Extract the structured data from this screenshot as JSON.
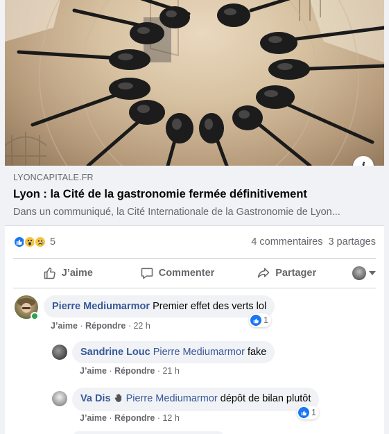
{
  "link": {
    "domain": "LYONCAPITALE.FR",
    "title": "Lyon : la Cité de la gastronomie fermée définitivement",
    "description": "Dans un communiqué, la Cité Internationale de la Gastronomie de Lyon...",
    "info_icon": "info-icon"
  },
  "stats": {
    "reaction_icons": [
      "like-icon",
      "wow-icon",
      "sad-icon"
    ],
    "reaction_count": "5",
    "comments": "4 commentaires",
    "shares": "3 partages"
  },
  "actions": {
    "like": "J’aime",
    "comment": "Commenter",
    "share": "Partager"
  },
  "comments": [
    {
      "author": "Pierre Mediumarmor",
      "text": "Premier effet des verts lol",
      "like": "J’aime",
      "reply": "Répondre",
      "time": "22 h",
      "likes": "1"
    },
    {
      "author": "Sandrine Louc",
      "tag": "Pierre Mediumarmor",
      "text": "fake",
      "like": "J’aime",
      "reply": "Répondre",
      "time": "21 h"
    },
    {
      "author": "Va Dis",
      "tag": "Pierre Mediumarmor",
      "text": "dépôt de bilan plutôt",
      "like": "J’aime",
      "reply": "Répondre",
      "time": "12 h",
      "likes": "1"
    }
  ],
  "colors": {
    "accent": "#1877f2",
    "name": "#385898",
    "muted": "#65676b"
  }
}
